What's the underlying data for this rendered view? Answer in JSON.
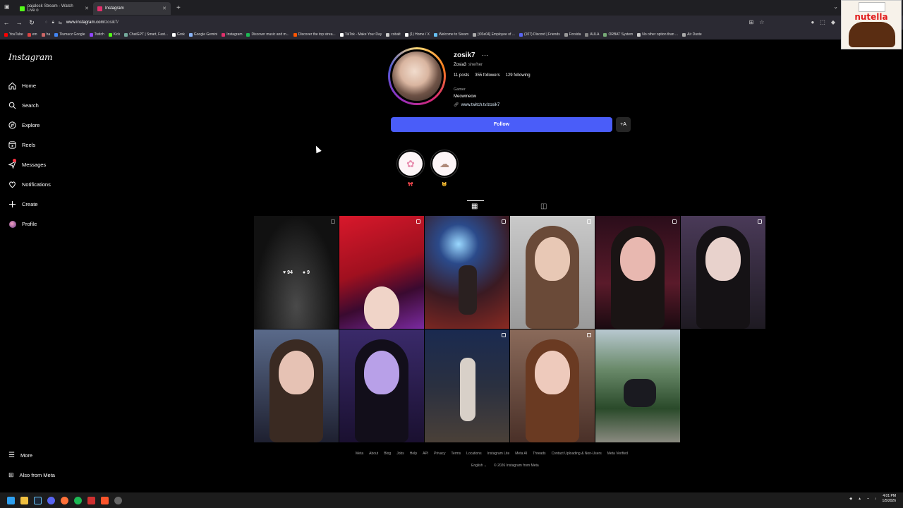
{
  "browser": {
    "tabs": [
      {
        "label": "pajalock Stream - Watch Live o",
        "color": "#53fc18"
      },
      {
        "label": "Instagram",
        "color": "#e1306c"
      }
    ],
    "url_host": "www.instagram.com",
    "url_path": "/zosik7/",
    "bookmarks": [
      {
        "label": "YouTube",
        "color": "#ff0000"
      },
      {
        "label": "em",
        "color": "#d44"
      },
      {
        "label": "ha",
        "color": "#c66"
      },
      {
        "label": "Tłumacz Google",
        "color": "#4285f4"
      },
      {
        "label": "Twitch",
        "color": "#9146ff"
      },
      {
        "label": "Kick",
        "color": "#53fc18"
      },
      {
        "label": "ChatGPT | Smart, Fast...",
        "color": "#74aa9c"
      },
      {
        "label": "Grok",
        "color": "#ffffff"
      },
      {
        "label": "Google Gemini",
        "color": "#8ab4f8"
      },
      {
        "label": "Instagram",
        "color": "#e1306c"
      },
      {
        "label": "Discover music and m...",
        "color": "#1db954"
      },
      {
        "label": "Discover the top strea...",
        "color": "#ff5500"
      },
      {
        "label": "TikTok - Make Your Day",
        "color": "#ffffff"
      },
      {
        "label": "cobalt",
        "color": "#cccccc"
      },
      {
        "label": "(1) Home / X",
        "color": "#ffffff"
      },
      {
        "label": "Welcome to Steam",
        "color": "#66c0f4"
      },
      {
        "label": "[t03e04] Employee of ...",
        "color": "#aaaaaa"
      },
      {
        "label": "(107) Discord | Friends",
        "color": "#5865f2"
      },
      {
        "label": "Forsida",
        "color": "#999999"
      },
      {
        "label": "AULA",
        "color": "#888888"
      },
      {
        "label": "ORBAT System",
        "color": "#77aa77"
      },
      {
        "label": "No other option than ...",
        "color": "#cccccc"
      },
      {
        "label": "Air Duste",
        "color": "#aaaaaa"
      }
    ]
  },
  "overlay": {
    "word": "nutella"
  },
  "sidebar": {
    "logo": "Instagram",
    "items": [
      {
        "label": "Home",
        "icon": "home-icon"
      },
      {
        "label": "Search",
        "icon": "search-icon"
      },
      {
        "label": "Explore",
        "icon": "explore-icon"
      },
      {
        "label": "Reels",
        "icon": "reels-icon"
      },
      {
        "label": "Messages",
        "icon": "messages-icon"
      },
      {
        "label": "Notifications",
        "icon": "heart-icon"
      },
      {
        "label": "Create",
        "icon": "plus-icon"
      },
      {
        "label": "Profile",
        "icon": "avatar-icon"
      }
    ],
    "more": "More",
    "also_from_meta": "Also from Meta"
  },
  "profile": {
    "username": "zosik7",
    "more": "···",
    "display_name": "Zosia3",
    "pronouns": "she/her",
    "posts": "11 posts",
    "followers": "355 followers",
    "following": "129 following",
    "category": "Gamer",
    "bio": "Meowmeow",
    "link": "www.twitch.tv/zosik7",
    "follow_label": "Follow",
    "suggest_label": "+A"
  },
  "highlights": [
    {
      "label": "🎀"
    },
    {
      "label": "😺"
    }
  ],
  "grid_first_post": {
    "likes": "94",
    "comments": "9"
  },
  "footer": {
    "links": [
      "Meta",
      "About",
      "Blog",
      "Jobs",
      "Help",
      "API",
      "Privacy",
      "Terms",
      "Locations",
      "Instagram Lite",
      "Meta AI",
      "Threads",
      "Contact Uploading & Non-Users",
      "Meta Verified"
    ],
    "language": "English",
    "copyright": "© 2026 Instagram from Meta"
  },
  "taskbar": {
    "time": "4:01 PM",
    "date": "1/5/2026"
  }
}
